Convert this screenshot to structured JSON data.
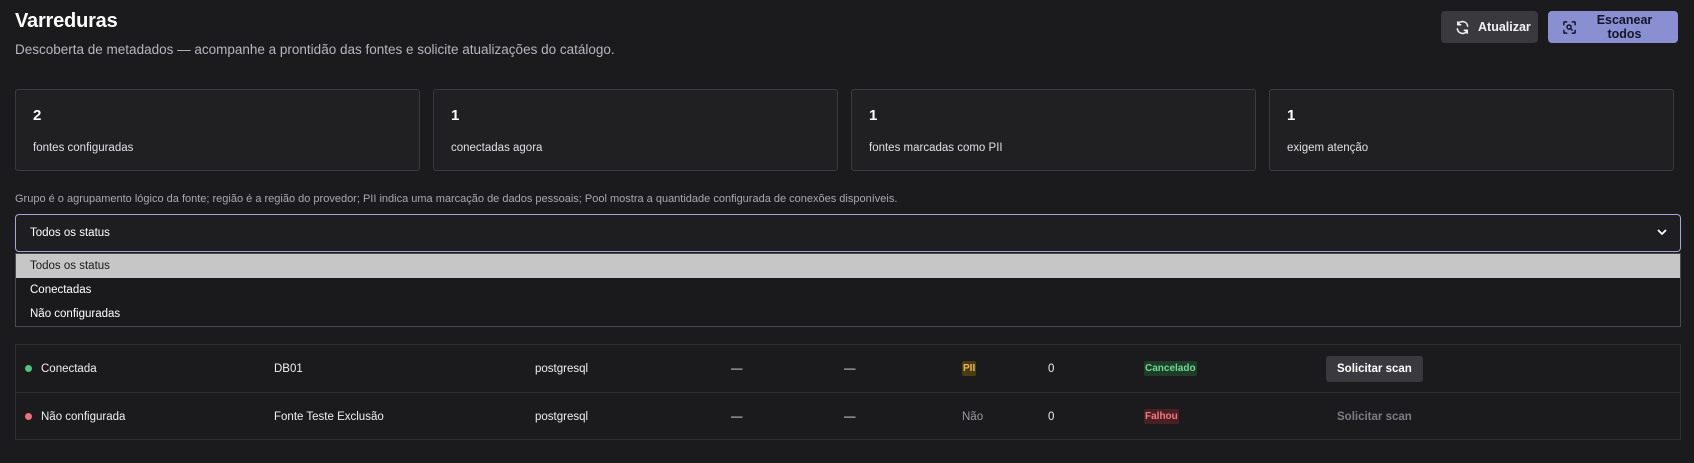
{
  "header": {
    "title": "Varreduras",
    "subtitle": "Descoberta de metadados — acompanhe a prontidão das fontes e solicite atualizações do catálogo."
  },
  "actions": {
    "refresh_label": "Atualizar",
    "scan_all_label": "Escanear todos"
  },
  "stats": [
    {
      "value": "2",
      "label": "fontes configuradas"
    },
    {
      "value": "1",
      "label": "conectadas agora"
    },
    {
      "value": "1",
      "label": "fontes marcadas como PII"
    },
    {
      "value": "1",
      "label": "exigem atenção"
    }
  ],
  "hint": "Grupo é o agrupamento lógico da fonte; região é a região do provedor; PII indica uma marcação de dados pessoais; Pool mostra a quantidade configurada de conexões disponíveis.",
  "filter": {
    "selected": "Todos os status",
    "options": [
      "Todos os status",
      "Conectadas",
      "Não configuradas"
    ]
  },
  "rows": [
    {
      "status": "Conectada",
      "status_color": "#4cc77a",
      "name": "DB01",
      "type": "postgresql",
      "group": "—",
      "region": "—",
      "pii": "PII",
      "pool": "0",
      "last_scan": "Cancelado",
      "action": "Solicitar scan"
    },
    {
      "status": "Não configurada",
      "status_color": "#f0707a",
      "name": "Fonte Teste Exclusão",
      "type": "postgresql",
      "group": "—",
      "region": "—",
      "pii": "Não",
      "pool": "0",
      "last_scan": "Falhou",
      "action": "Solicitar scan"
    }
  ],
  "colors": {
    "accent": "#8a8fd1",
    "connected": "#4cc77a",
    "not_configured": "#f0707a"
  }
}
